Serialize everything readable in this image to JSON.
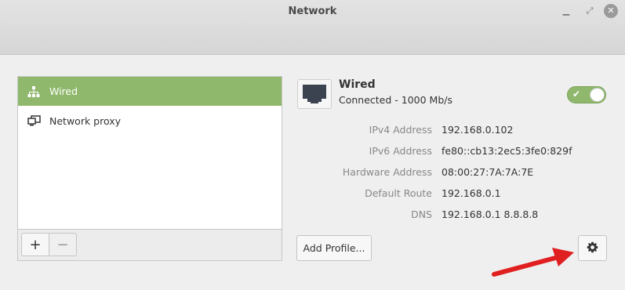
{
  "window": {
    "title": "Network"
  },
  "sidebar": {
    "items": [
      {
        "label": "Wired",
        "icon": "network-wired-icon",
        "selected": true
      },
      {
        "label": "Network proxy",
        "icon": "network-proxy-icon",
        "selected": false
      }
    ],
    "add_label": "+",
    "remove_label": "−"
  },
  "device": {
    "name": "Wired",
    "status": "Connected - 1000 Mb/s",
    "enabled": true,
    "details": [
      {
        "key": "IPv4 Address",
        "value": "192.168.0.102"
      },
      {
        "key": "IPv6 Address",
        "value": "fe80::cb13:2ec5:3fe0:829f"
      },
      {
        "key": "Hardware Address",
        "value": "08:00:27:7A:7A:7E"
      },
      {
        "key": "Default Route",
        "value": "192.168.0.1"
      },
      {
        "key": "DNS",
        "value": "192.168.0.1 8.8.8.8"
      }
    ]
  },
  "actions": {
    "add_profile_label": "Add Profile..."
  },
  "colors": {
    "accent": "#8fb86c",
    "annotation_arrow": "#e02020"
  }
}
